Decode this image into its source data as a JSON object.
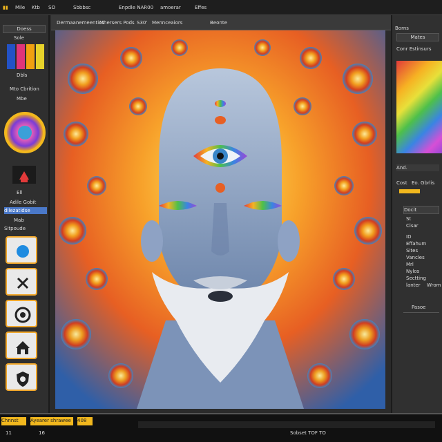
{
  "menubar": {
    "items": [
      "Mile",
      "Ktb",
      "SO",
      "Sbbbsc",
      "Enpdle NAR00",
      "amoerar",
      "Effes"
    ]
  },
  "doc_tabs": {
    "items": [
      "Dermaanemeentics",
      "Mhersers Pods",
      "S30'",
      "Mennceaiors",
      "Beonte"
    ]
  },
  "left_panel": {
    "title": "Doess",
    "swatch_label": "Sole",
    "swatch_caption": "Dbls",
    "section1": "Mto Cbrition",
    "section1_sub": "Mbe",
    "adjust_label": "Adile Gobit",
    "adjust_sub": "dilezatidse",
    "adjust_sub2": "Mab",
    "tools_title": "Sitpoude"
  },
  "right_panel": {
    "title": "Borns",
    "subtitle": "Mates",
    "color_label": "Conr Estinsurs",
    "and_label": "And.",
    "cost_label": "Cost",
    "sub_label": "Eo. Gbrlis",
    "props_header": "Docit",
    "props_items": [
      "St",
      "Cisar",
      "ID",
      "Effahum",
      "Sites",
      "Vancles",
      "Mrl",
      "Nylos",
      "Sectting",
      "lanter",
      "Wrom",
      "Pasoe"
    ]
  },
  "bottom": {
    "tag1": "Chnnst",
    "tag2": "Ayearer shrawee",
    "zoom": "408",
    "status": "Sobset TOF TO",
    "left_nums": [
      "11",
      "16"
    ]
  },
  "colors": {
    "accent": "#f2b81e",
    "panel_bg": "#2f2f2f",
    "highlight_blue": "#4a78c8"
  }
}
